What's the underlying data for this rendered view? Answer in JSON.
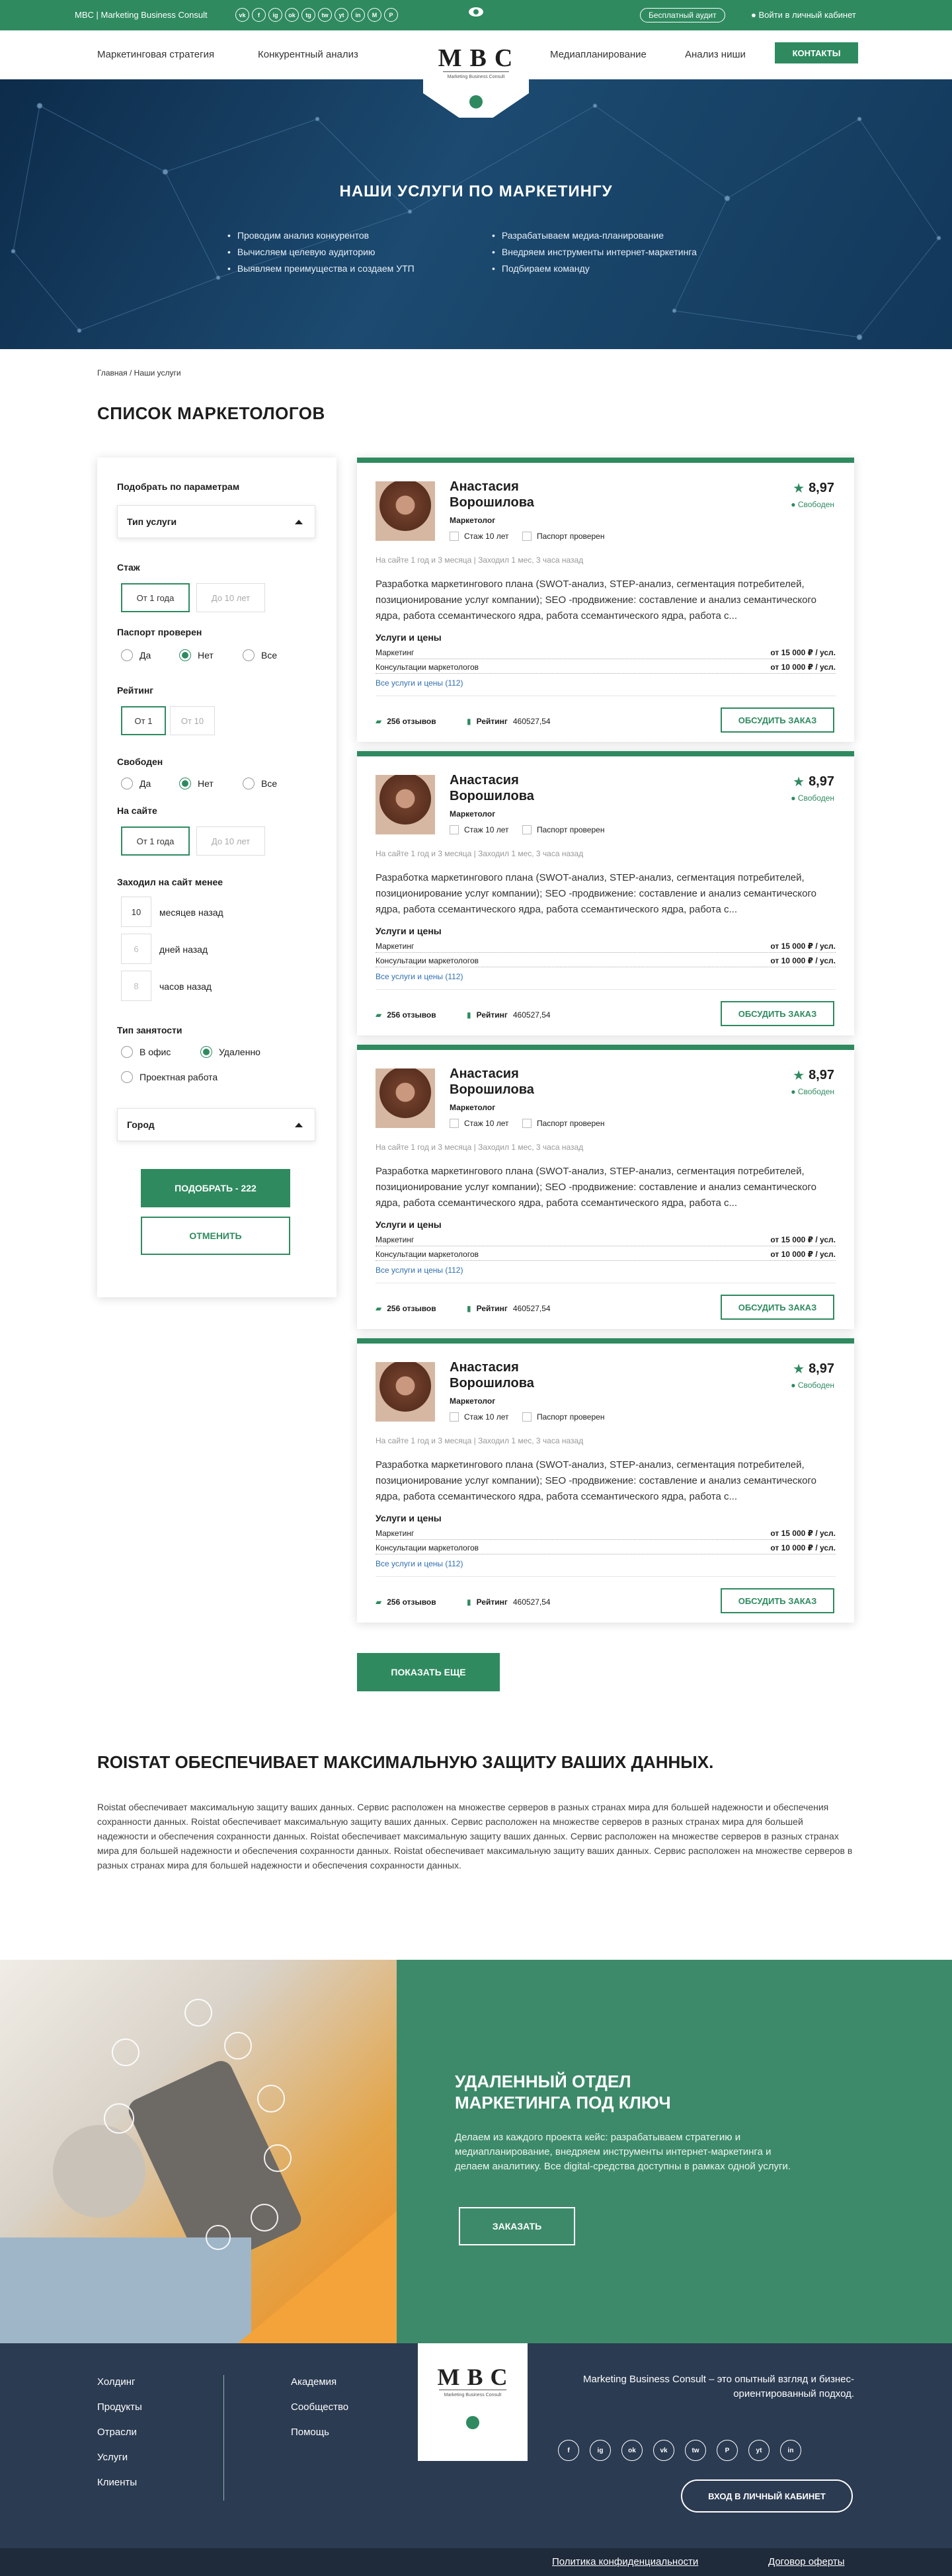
{
  "topbar": {
    "brand": "MBC | Marketing Business Consult",
    "socials": [
      "vk",
      "f",
      "ig",
      "ok",
      "tg",
      "tw",
      "yt",
      "in",
      "M",
      "P"
    ],
    "audit": "Бесплатный аудит",
    "login": "Войти в личный кабинет"
  },
  "nav": {
    "items": [
      "Маркетинговая стратегия",
      "Конкурентный анализ",
      "Медиапланирование",
      "Анализ ниши"
    ],
    "contacts": "КОНТАКТЫ"
  },
  "logo": {
    "letters": "MBC",
    "tagline": "Marketing Business Consult"
  },
  "hero": {
    "title": "НАШИ УСЛУГИ ПО МАРКЕТИНГУ",
    "left": [
      "Проводим анализ конкурентов",
      "Вычисляем целевую аудиторию",
      "Выявляем преимущества и создаем УТП"
    ],
    "right": [
      "Разрабатываем медиа-планирование",
      "Внедряем инструменты интернет-маркетинга",
      "Подбираем команду"
    ]
  },
  "breadcrumb": "Главная / Наши услуги",
  "page_title": "СПИСОК МАРКЕТОЛОГОВ",
  "filter": {
    "title": "Подобрать по параметрам",
    "type_select": "Тип услуги",
    "stazh": "Стаж",
    "stazh_from": "От 1 года",
    "stazh_to": "До 10 лет",
    "passport": "Паспорт проверен",
    "yes": "Да",
    "no": "Нет",
    "all": "Все",
    "rating": "Рейтинг",
    "rating_from": "От 1",
    "rating_to": "От 10",
    "free": "Свободен",
    "on_site": "На сайте",
    "site_from": "От 1 года",
    "site_to": "До 10 лет",
    "visited": "Заходил на сайт менее",
    "months_val": "10",
    "months": "месяцев назад",
    "days_val": "6",
    "days": "дней назад",
    "hours_val": "8",
    "hours": "часов назад",
    "employment": "Тип занятости",
    "office": "В офис",
    "remote": "Удаленно",
    "project": "Проектная работа",
    "city": "Город",
    "submit": "ПОДОБРАТЬ - 222",
    "cancel": "ОТМЕНИТЬ"
  },
  "card": {
    "name": "Анастасия Ворошилова",
    "role": "Маркетолог",
    "stazh": "Стаж 10 лет",
    "passport": "Паспорт проверен",
    "rating": "8,97",
    "status": "Свободен",
    "seen": "На сайте 1 год и 3 месяца | Заходил 1 мес, 3 часа назад",
    "desc": "Разработка маркетингового плана (SWOT-анализ, STEP-анализ, сегментация потребителей, позиционирование услуг компании); SEO -продвижение: составление и анализ семантического ядра, работа ссемантического ядра, работа ссемантического ядра, работа с...",
    "services_title": "Услуги и цены",
    "svc1": "Маркетинг",
    "price1": "от 15 000 ₽ / усл.",
    "svc2": "Консультации маркетологов",
    "price2": "от 10 000 ₽ / усл.",
    "all_services": "Все услуги и цены (112)",
    "reviews": "256 отзывов",
    "rating_label": "Рейтинг",
    "rating_value": "460527,54",
    "discuss": "ОБСУДИТЬ ЗАКАЗ"
  },
  "show_more": "ПОКАЗАТЬ ЕЩЕ",
  "roistat": {
    "title": "ROISTAT ОБЕСПЕЧИВАЕТ МАКСИМАЛЬНУЮ ЗАЩИТУ ВАШИХ ДАННЫХ.",
    "text": "Roistat обеспечивает максимальную защиту ваших данных. Сервис расположен на множестве серверов в разных странах мира для большей надежности и обеспечения сохранности данных. Roistat обеспечивает максимальную защиту ваших данных. Сервис расположен на множестве серверов в разных странах мира для большей надежности и обеспечения сохранности данных. Roistat обеспечивает максимальную защиту ваших данных. Сервис расположен на множестве серверов в разных странах мира для большей надежности и обеспечения сохранности данных. Roistat обеспечивает максимальную защиту ваших данных. Сервис расположен на множестве серверов в разных странах мира для большей надежности и обеспечения сохранности данных."
  },
  "promo": {
    "title": "УДАЛЕННЫЙ ОТДЕЛ МАРКЕТИНГА ПОД КЛЮЧ",
    "text": "Делаем из каждого проекта кейс: разрабатываем стратегию и медиапланирование, внедряем инструменты интернет-маркетинга и делаем аналитику. Все digital-средства доступны в рамках одной услуги.",
    "button": "ЗАКАЗАТЬ"
  },
  "footer": {
    "col1": [
      "Холдинг",
      "Продукты",
      "Отрасли",
      "Услуги",
      "Клиенты"
    ],
    "col2": [
      "Академия",
      "Сообщество",
      "Помощь"
    ],
    "about": "Marketing Business Consult – это опытный взгляд и бизнес-ориентированный подход.",
    "socials": [
      "f",
      "ig",
      "ok",
      "vk",
      "tw",
      "P",
      "yt",
      "in"
    ],
    "cabinet": "ВХОД В ЛИЧНЫЙ КАБИНЕТ",
    "privacy": "Политика конфиденциальности",
    "offer": "Договор оферты"
  },
  "colors": {
    "accent": "#2f8a60",
    "footer": "#2b3b52",
    "hero": "#163c60"
  }
}
